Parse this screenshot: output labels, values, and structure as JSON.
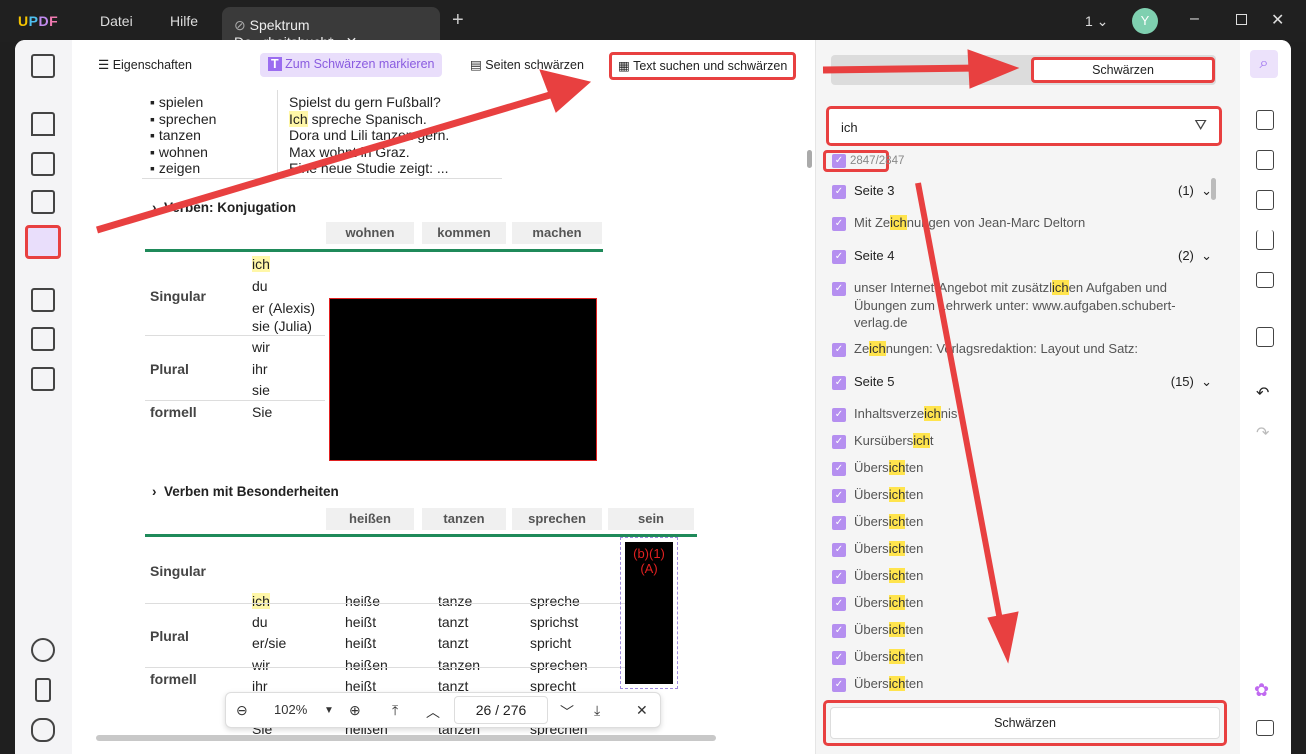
{
  "titlebar": {
    "logo": "UPDF",
    "menu": [
      "Datei",
      "Hilfe"
    ],
    "tab_title": "Spektrum De...rbeitsbuch*",
    "page_indicator": "1",
    "avatar": "Y"
  },
  "toolbar": {
    "properties": "Eigenschaften",
    "mark_redact": "Zum Schwärzen markieren",
    "redact_pages": "Seiten schwärzen",
    "search_redact": "Text suchen und schwärzen"
  },
  "doc": {
    "verbs": [
      "spielen",
      "sprechen",
      "tanzen",
      "wohnen",
      "zeigen"
    ],
    "sentences": [
      "Spielst du gern Fußball?",
      "Ich spreche Spanisch.",
      "Dora und Lili tanzen gern.",
      "Max wohnt in Graz.",
      "Eine neue Studie zeigt: ..."
    ],
    "section1": "Verben: Konjugation",
    "t1_headers": [
      "wohnen",
      "kommen",
      "machen"
    ],
    "t1_groups": [
      "Singular",
      "Plural",
      "formell"
    ],
    "t1_pronouns": [
      "ich",
      "du",
      "er (Alexis)",
      "sie (Julia)",
      "wir",
      "ihr",
      "sie",
      "Sie"
    ],
    "section2": "Verben mit Besonderheiten",
    "t2_headers": [
      "heißen",
      "tanzen",
      "sprechen",
      "sein"
    ],
    "t2_pronouns": [
      "ich",
      "du",
      "er/sie",
      "wir",
      "ihr",
      "sie",
      "Sie"
    ],
    "t2_heissen": [
      "heiße",
      "heißt",
      "heißt",
      "heißen",
      "heißt",
      "heißen",
      "heißen"
    ],
    "t2_tanzen": [
      "tanze",
      "tanzt",
      "tanzt",
      "tanzen",
      "tanzt",
      "tanzen",
      "tanzen"
    ],
    "t2_sprechen": [
      "spreche",
      "sprichst",
      "spricht",
      "sprechen",
      "sprecht",
      "sprechen",
      "sprechen"
    ],
    "redact_label": "(b)(1)(A)"
  },
  "zoombar": {
    "zoom": "102%",
    "page": "26",
    "total": "/ 276"
  },
  "panel": {
    "tab_active": "Schwärzen",
    "search_value": "ich",
    "count": "2847/2847",
    "results": [
      {
        "type": "page",
        "label": "Seite 3",
        "count": "(1)"
      },
      {
        "type": "hit",
        "pre": "Mit Ze",
        "hit": "ich",
        "post": "nungen von Jean-Marc Deltorn"
      },
      {
        "type": "page",
        "label": "Seite 4",
        "count": "(2)"
      },
      {
        "type": "hit",
        "pre": "unser Internet-Angebot mit zusätzl",
        "hit": "ich",
        "post": "en Aufgaben und",
        "line2": "Übungen zum Lehrwerk unter: www.aufgaben.schubert-",
        "line3": "verlag.de"
      },
      {
        "type": "hit",
        "pre": "Ze",
        "hit": "ich",
        "post": "nungen: Verlagsredaktion: Layout und Satz:"
      },
      {
        "type": "page",
        "label": "Seite 5",
        "count": "(15)"
      },
      {
        "type": "hit",
        "pre": "Inhaltsverze",
        "hit": "ich",
        "post": "nis"
      },
      {
        "type": "hit",
        "pre": "Kursübers",
        "hit": "ich",
        "post": "t"
      },
      {
        "type": "hit",
        "pre": "Übers",
        "hit": "ich",
        "post": "ten"
      },
      {
        "type": "hit",
        "pre": "Übers",
        "hit": "ich",
        "post": "ten"
      },
      {
        "type": "hit",
        "pre": "Übers",
        "hit": "ich",
        "post": "ten"
      },
      {
        "type": "hit",
        "pre": "Übers",
        "hit": "ich",
        "post": "ten"
      },
      {
        "type": "hit",
        "pre": "Übers",
        "hit": "ich",
        "post": "ten"
      },
      {
        "type": "hit",
        "pre": "Übers",
        "hit": "ich",
        "post": "ten"
      },
      {
        "type": "hit",
        "pre": "Übers",
        "hit": "ich",
        "post": "ten"
      },
      {
        "type": "hit",
        "pre": "Übers",
        "hit": "ich",
        "post": "ten"
      },
      {
        "type": "hit",
        "pre": "Übers",
        "hit": "ich",
        "post": "ten"
      }
    ],
    "apply_button": "Schwärzen"
  },
  "colors": {
    "accent": "#b58ff0",
    "annotation": "#e84040",
    "highlight": "#ffe44d",
    "table_rule": "#1f8a5a"
  }
}
